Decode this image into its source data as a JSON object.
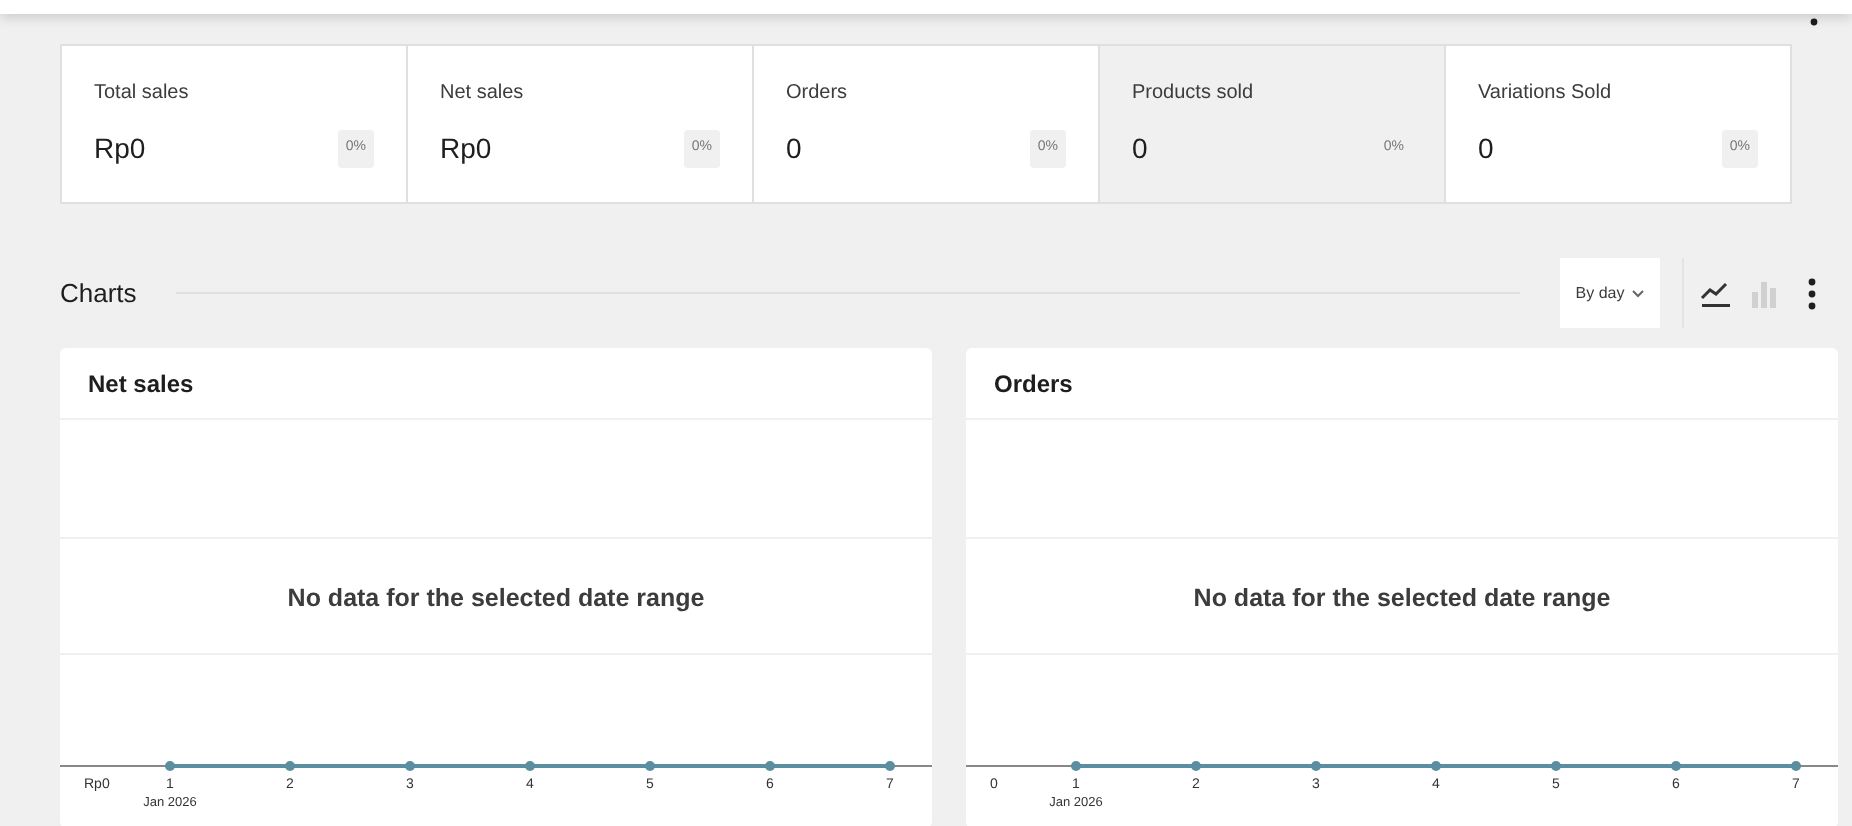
{
  "tiles": [
    {
      "label": "Total sales",
      "value": "Rp0",
      "delta": "0%",
      "selected": false
    },
    {
      "label": "Net sales",
      "value": "Rp0",
      "delta": "0%",
      "selected": false
    },
    {
      "label": "Orders",
      "value": "0",
      "delta": "0%",
      "selected": false
    },
    {
      "label": "Products sold",
      "value": "0",
      "delta": "0%",
      "selected": true
    },
    {
      "label": "Variations Sold",
      "value": "0",
      "delta": "0%",
      "selected": false
    }
  ],
  "charts_header": {
    "title": "Charts",
    "interval": "By day",
    "chart_types": [
      {
        "kind": "line",
        "selected": true
      },
      {
        "kind": "bar",
        "selected": false
      }
    ]
  },
  "charts": [
    {
      "title": "Net sales",
      "message": "No data for the selected date range",
      "y_label": "Rp0",
      "x_labels": [
        "1",
        "2",
        "3",
        "4",
        "5",
        "6",
        "7"
      ],
      "x_sublabel": "Jan 2026"
    },
    {
      "title": "Orders",
      "message": "No data for the selected date range",
      "y_label": "0",
      "x_labels": [
        "1",
        "2",
        "3",
        "4",
        "5",
        "6",
        "7"
      ],
      "x_sublabel": "Jan 2026"
    }
  ]
}
